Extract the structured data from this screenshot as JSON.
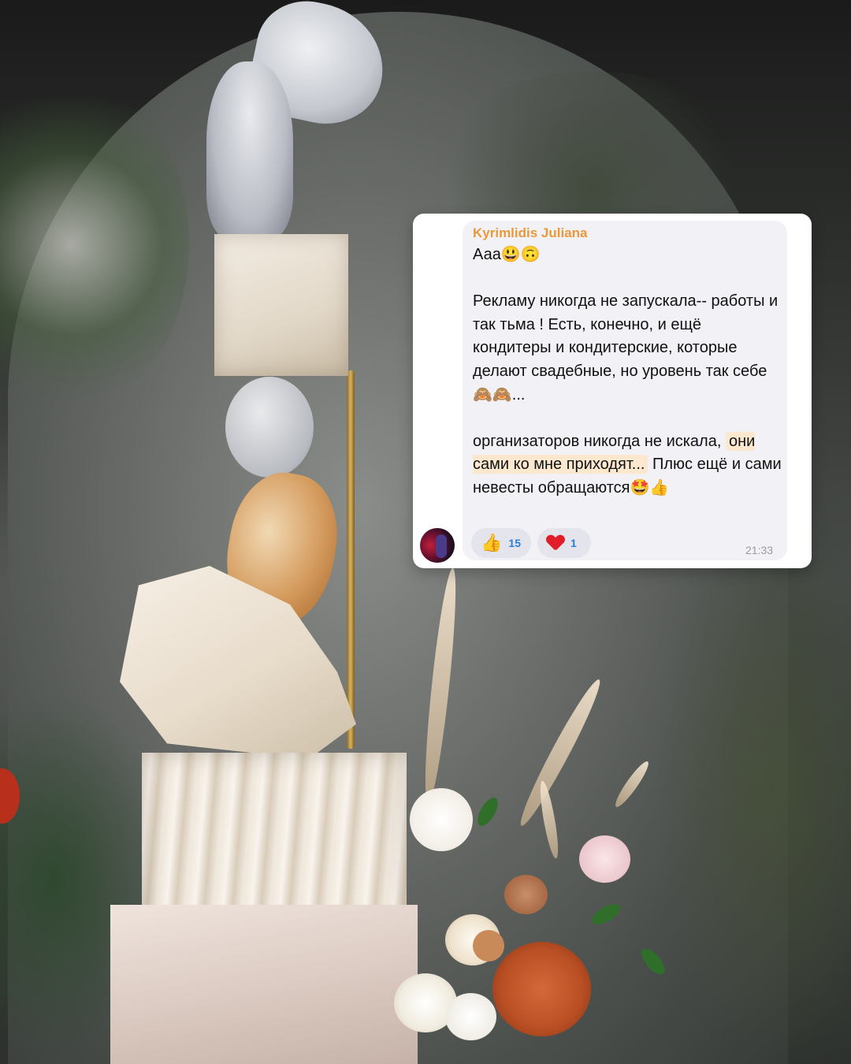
{
  "message": {
    "sender": "Kyrimlidis Juliana",
    "line1": "Ааа😃🙃",
    "paragraph2": "Рекламу никогда не запускала-- работы и так тьма !  Есть, конечно, и ещё кондитеры и кондитерские, которые делают свадебные, но уровень так себе 🙈🙈...",
    "p3_before": "организаторов никогда не искала,",
    "p3_highlight": "они сами ко мне приходят...",
    "p3_after": " Плюс ещё и сами невесты обращаются🤩👍",
    "time": "21:33",
    "highlight_color": "#fbe8cf",
    "sender_color": "#e89a3b"
  },
  "reactions": [
    {
      "emoji": "👍",
      "count": "15",
      "icon": "thumbs-up-icon"
    },
    {
      "emoji": "❤",
      "count": "1",
      "icon": "heart-icon"
    }
  ]
}
